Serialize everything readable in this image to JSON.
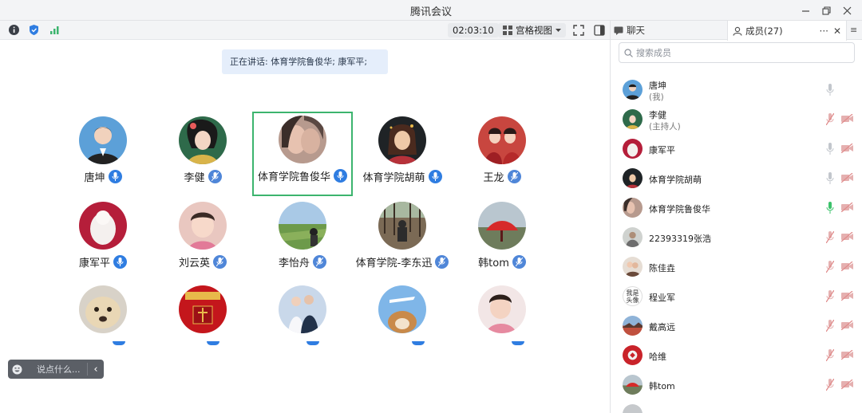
{
  "window": {
    "title": "腾讯会议",
    "buttons": [
      "minimize-icon",
      "restore-icon",
      "close-icon"
    ]
  },
  "toolbar": {
    "icons": [
      "info-icon",
      "shield-icon",
      "signal-icon"
    ],
    "timer": "02:03:10",
    "view_label": "宫格视图",
    "fullscreen_icon": "fullscreen-icon",
    "sidebar_icon": "sidebar-toggle-icon"
  },
  "speaking": {
    "text": "正在讲话: 体育学院鲁俊华; 康军平;"
  },
  "grid": {
    "row1": [
      {
        "name": "唐坤",
        "mic": "on"
      },
      {
        "name": "李健",
        "mic": "muted"
      },
      {
        "name": "体育学院鲁俊华",
        "mic": "on",
        "active": true
      },
      {
        "name": "体育学院胡萌",
        "mic": "on"
      },
      {
        "name": "王龙",
        "mic": "muted"
      }
    ],
    "row2": [
      {
        "name": "康军平",
        "mic": "on"
      },
      {
        "name": "刘云英",
        "mic": "muted"
      },
      {
        "name": "李怡舟",
        "mic": "muted"
      },
      {
        "name": "体育学院-李东迅",
        "mic": "muted"
      },
      {
        "name": "韩tom",
        "mic": "muted"
      }
    ]
  },
  "chat_input": {
    "placeholder": "说点什么..."
  },
  "panel": {
    "chat_tab": "聊天",
    "members_tab": "成员(27)",
    "search_placeholder": "搜索成员",
    "members": [
      {
        "name": "唐坤",
        "role": "(我)",
        "mic": "idle",
        "cam": "none"
      },
      {
        "name": "李健",
        "role": "(主持人)",
        "mic": "muted",
        "cam": "off"
      },
      {
        "name": "康军平",
        "role": "",
        "mic": "idle",
        "cam": "off"
      },
      {
        "name": "体育学院胡萌",
        "role": "",
        "mic": "idle",
        "cam": "off"
      },
      {
        "name": "体育学院鲁俊华",
        "role": "",
        "mic": "speaking",
        "cam": "off"
      },
      {
        "name": "22393319张浩",
        "role": "",
        "mic": "muted",
        "cam": "off"
      },
      {
        "name": "陈佳垚",
        "role": "",
        "mic": "muted",
        "cam": "off"
      },
      {
        "name": "程业军",
        "role": "",
        "mic": "muted",
        "cam": "off",
        "avatar_text": "我是头像"
      },
      {
        "name": "戴高远",
        "role": "",
        "mic": "muted",
        "cam": "off"
      },
      {
        "name": "哈维",
        "role": "",
        "mic": "muted",
        "cam": "off"
      },
      {
        "name": "韩tom",
        "role": "",
        "mic": "muted",
        "cam": "off"
      }
    ]
  },
  "colors": {
    "accent": "#2f7de1",
    "active_border": "#3cb46e",
    "speaking_mic": "#3cc26b",
    "muted_red": "#e08a8a"
  }
}
